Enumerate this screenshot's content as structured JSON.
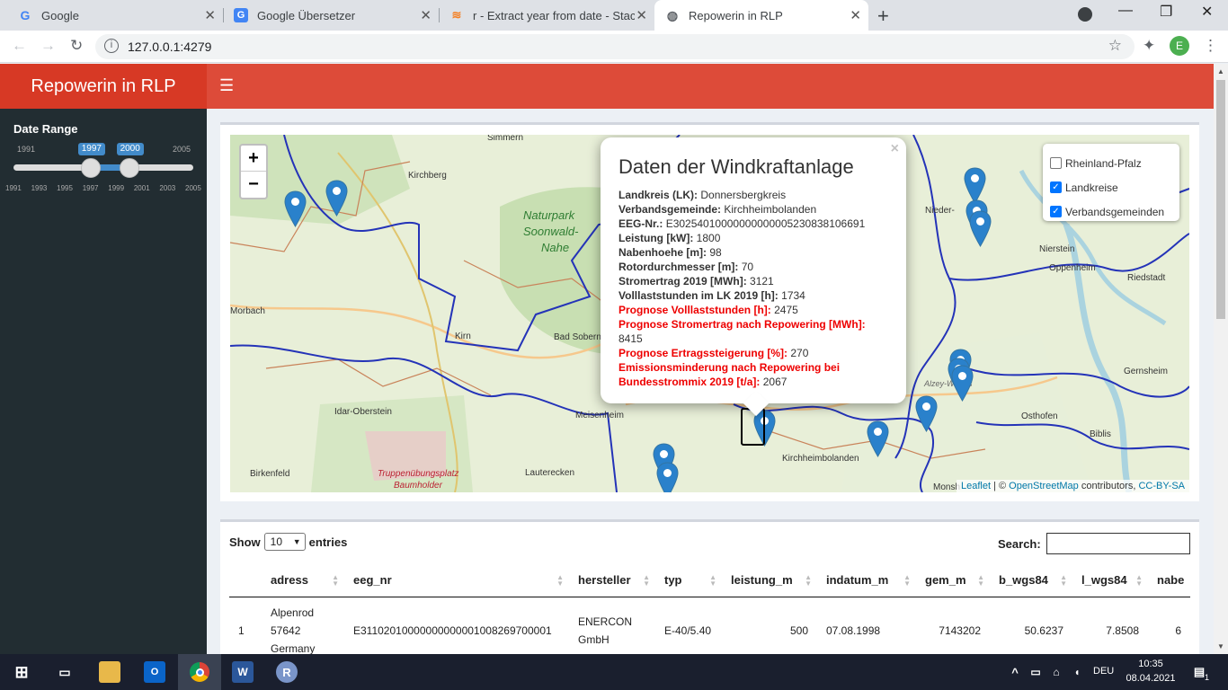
{
  "browser": {
    "tabs": [
      {
        "title": "Google",
        "favicon": "google-icon"
      },
      {
        "title": "Google Übersetzer",
        "favicon": "translate-icon"
      },
      {
        "title": "r - Extract year from date - Stack",
        "favicon": "stackoverflow-icon"
      },
      {
        "title": "Repowerin in RLP",
        "favicon": "globe-icon",
        "active": true
      }
    ],
    "url": "127.0.0.1:4279",
    "profile_initial": "E"
  },
  "app": {
    "title": "Repowerin in RLP",
    "header_color": "#dd4b39"
  },
  "sidebar": {
    "date_range_label": "Date Range",
    "slider": {
      "min": 1991,
      "max": 2005,
      "from": 1997,
      "to": 2000,
      "min_label": "1991",
      "max_label": "2005",
      "from_label": "1997",
      "to_label": "2000",
      "ticks": [
        "1991",
        "1993",
        "1995",
        "1997",
        "1999",
        "2001",
        "2003",
        "2005"
      ]
    }
  },
  "map": {
    "zoom_in": "+",
    "zoom_out": "−",
    "layers": [
      {
        "label": "Rheinland-Pfalz",
        "checked": false
      },
      {
        "label": "Landkreise",
        "checked": true
      },
      {
        "label": "Verbandsgemeinden",
        "checked": true
      }
    ],
    "attribution": {
      "leaflet": "Leaflet",
      "sep": " | © ",
      "osm": "OpenStreetMap",
      "contrib": " contributors, ",
      "license": "CC-BY-SA"
    },
    "place_labels": [
      "Simmern",
      "Kirchberg",
      "Naturpark",
      "Soonwald-",
      "Nahe",
      "Morbach",
      "Kirn",
      "Bad Sobernh",
      "Idar-Oberstein",
      "Meisenheim",
      "Birkenfeld",
      "Lauterecken",
      "Truppenübungsplatz",
      "Baumholder",
      "Kirchheimbolanden",
      "Osthofen",
      "Biblis",
      "Gernsheim",
      "Riedstadt",
      "Oppenheim",
      "Nierstein",
      "Nieder-",
      "Monsh",
      "Alzey-Worms"
    ],
    "popup": {
      "title": "Daten der Windkraftanlage",
      "close": "×",
      "rows": [
        {
          "key": "Landkreis (LK):",
          "value": "Donnersbergkreis",
          "highlight": false
        },
        {
          "key": "Verbandsgemeinde:",
          "value": "Kirchheimbolanden",
          "highlight": false
        },
        {
          "key": "EEG-Nr.:",
          "value": "E30254010000000000005230838106691",
          "highlight": false
        },
        {
          "key": "Leistung [kW]:",
          "value": "1800",
          "highlight": false
        },
        {
          "key": "Nabenhoehe [m]:",
          "value": "98",
          "highlight": false
        },
        {
          "key": "Rotordurchmesser [m]:",
          "value": "70",
          "highlight": false
        },
        {
          "key": "Stromertrag 2019 [MWh]:",
          "value": "3121",
          "highlight": false
        },
        {
          "key": "Volllaststunden im LK 2019 [h]:",
          "value": "1734",
          "highlight": false
        },
        {
          "key": "Prognose Volllaststunden [h]:",
          "value": "2475",
          "highlight": true
        },
        {
          "key": "Prognose Stromertrag nach Repowering [MWh]:",
          "value": "8415",
          "highlight": true
        },
        {
          "key": "Prognose Ertragssteigerung [%]:",
          "value": "270",
          "highlight": true
        },
        {
          "key": "Emissionsminderung nach Repowering bei Bundesstrommix 2019 [t/a]:",
          "value": "2067",
          "highlight": true
        }
      ]
    }
  },
  "table": {
    "show_label": "Show",
    "entries_value": "10",
    "entries_label": "entries",
    "search_label": "Search:",
    "columns": [
      "",
      "adress",
      "eeg_nr",
      "hersteller",
      "typ",
      "leistung_m",
      "indatum_m",
      "gem_m",
      "b_wgs84",
      "l_wgs84",
      "nabe"
    ],
    "rows": [
      {
        "idx": "1",
        "adress": "Alpenrod 57642 Germany",
        "eeg_nr": "E31102010000000000001008269700001",
        "hersteller": "ENERCON GmbH",
        "typ": "E-40/5.40",
        "leistung_m": "500",
        "indatum_m": "07.08.1998",
        "gem_m": "7143202",
        "b_wgs84": "50.6237",
        "l_wgs84": "7.8508",
        "nabe": "6"
      }
    ]
  },
  "taskbar": {
    "language": "DEU",
    "time": "10:35",
    "date": "08.04.2021",
    "notification_count": "1"
  }
}
